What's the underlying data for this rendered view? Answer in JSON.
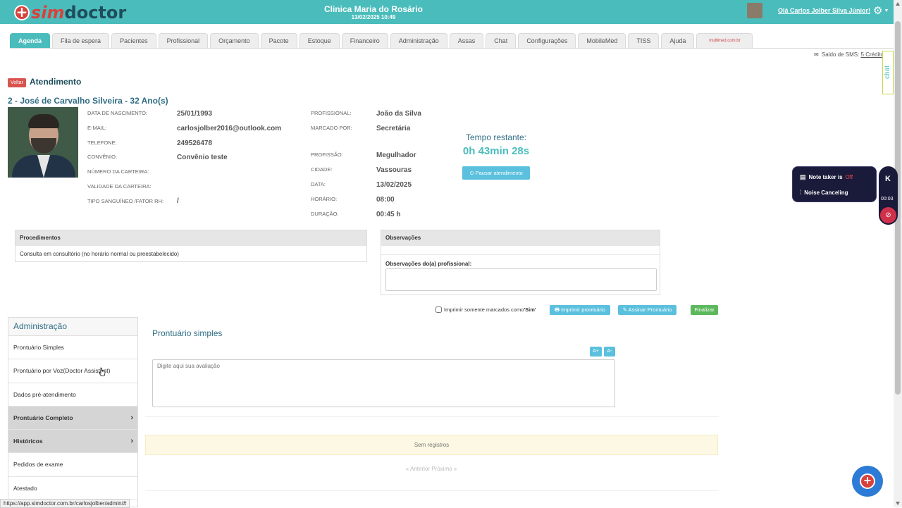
{
  "header": {
    "logo_sim": "sim",
    "logo_doctor": "doctor",
    "clinic_name": "Clinica Maria do Rosário",
    "datetime": "13/02/2025 10:49",
    "greeting": "Olá Carlos Jolber Silva Júnior!"
  },
  "tabs": [
    {
      "label": "Agenda",
      "active": true
    },
    {
      "label": "Fila de espera"
    },
    {
      "label": "Pacientes"
    },
    {
      "label": "Profissional"
    },
    {
      "label": "Orçamento"
    },
    {
      "label": "Pacote"
    },
    {
      "label": "Estoque"
    },
    {
      "label": "Financeiro"
    },
    {
      "label": "Administração"
    },
    {
      "label": "Assas"
    },
    {
      "label": "Chat"
    },
    {
      "label": "Configurações"
    },
    {
      "label": "MobileMed"
    },
    {
      "label": "TISS"
    },
    {
      "label": "Ajuda"
    },
    {
      "label": "multimed.com.br"
    }
  ],
  "sms": {
    "label": "Saldo de SMS:",
    "credits": "5 Créditos"
  },
  "chat_widget": "chat",
  "atendimento": {
    "back_label": "Voltar",
    "title": "Atendimento",
    "patient_header": "2 - José de Carvalho Silveira - 32 Ano(s)"
  },
  "patient": {
    "birth_label": "Data de nascimento:",
    "birth": "25/01/1993",
    "email_label": "E-mail:",
    "email": "carlosjolber2016@outlook.com",
    "phone_label": "Telefone:",
    "phone": "249526478",
    "insurance_label": "Convênio:",
    "insurance": "Convênio teste",
    "card_number_label": "Número da carteira:",
    "card_validity_label": "Validade da carteira:",
    "blood_label": "Tipo sanguíneo /Fator RH:",
    "blood": "/"
  },
  "appointment": {
    "professional_label": "Profissional:",
    "professional": "João da Silva",
    "booked_by_label": "Marcado por:",
    "booked_by": "Secretária",
    "profession_label": "Profissão:",
    "profession": "Megulhador",
    "city_label": "Cidade:",
    "city": "Vassouras",
    "date_label": "Data:",
    "date": "13/02/2025",
    "time_label": "Horário:",
    "time": "08:00",
    "duration_label": "Duração:",
    "duration": "00:45 h"
  },
  "timer": {
    "label": "Tempo restante:",
    "value": "0h 43min 28s",
    "pause_label": "⊙ Pausar atendimento"
  },
  "procedures": {
    "title": "Procedimentos",
    "item": "Consulta em consultório (no horário normal ou preestabelecido)"
  },
  "observations": {
    "title": "Observações",
    "professional_label": "Observações do(a) profissional:"
  },
  "actions": {
    "print_only_marked_pre": "Imprimir somente marcados como ",
    "print_only_marked_sim": "'Sim'",
    "print_record": "🖶 Imprimir prontuário",
    "sign_record": "✎ Assinar Prontuário",
    "finish": "Finalizar"
  },
  "sidebar": {
    "title": "Administração",
    "items": [
      {
        "label": "Prontuário Simples"
      },
      {
        "label": "Prontuário por Voz(Doctor Assistent)"
      },
      {
        "label": "Dados pré-atendimento"
      },
      {
        "label": "Prontuário Completo",
        "group": true
      },
      {
        "label": "Históricos",
        "group": true
      },
      {
        "label": "Pedidos de exame"
      },
      {
        "label": "Atestado"
      }
    ]
  },
  "record": {
    "title": "Prontuário simples",
    "font_inc": "A+",
    "font_dec": "A-",
    "placeholder": "Digite aqui sua avaliação",
    "no_records": "Sem registros",
    "pager": "« Anterior Próximo »"
  },
  "status_url": "https://app.simdoctor.com.br/carlosjolber/admin/#",
  "notetaker": {
    "label": "Note taker is",
    "state": "Off",
    "noise": "Noise Canceling",
    "timer": "00:03"
  },
  "colors": {
    "primary": "#4bbcbc",
    "danger": "#d9534f",
    "success": "#5cb85c",
    "info": "#5bc0de",
    "title": "#2f6d85"
  }
}
